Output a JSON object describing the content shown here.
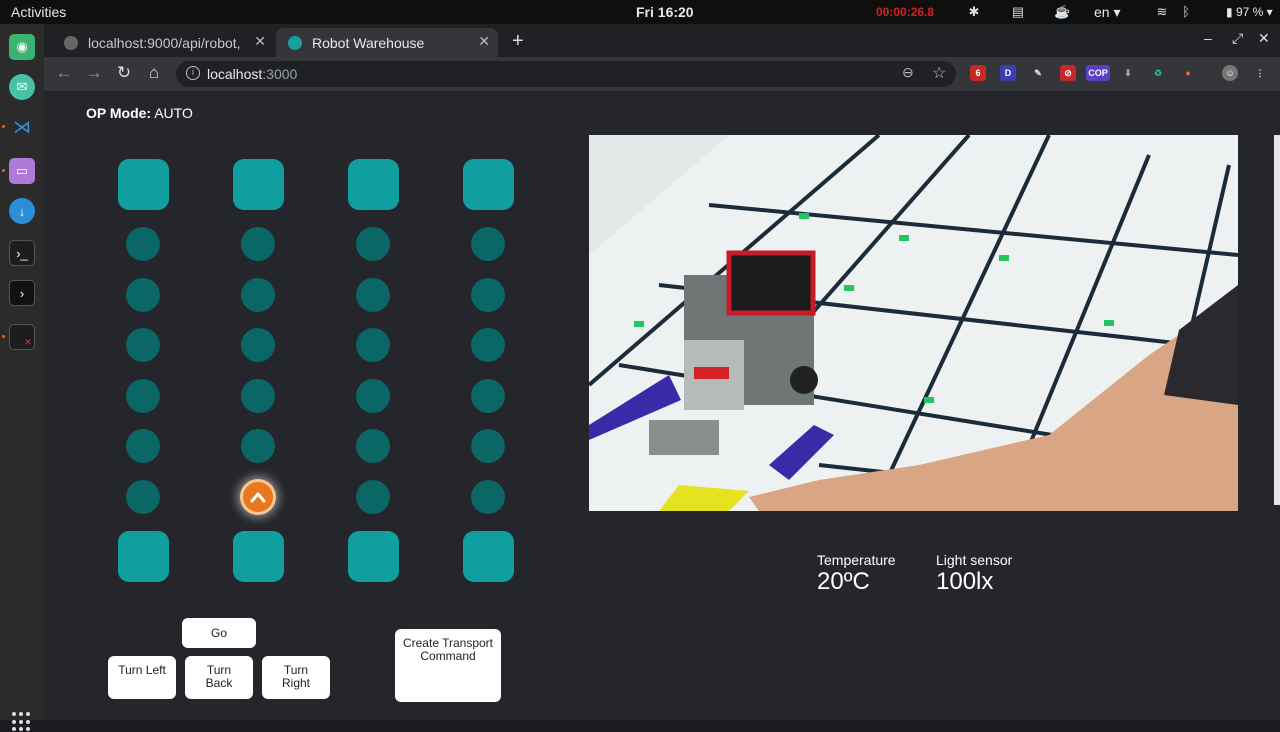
{
  "system": {
    "activities_label": "Activities",
    "clock": "Fri 16:20",
    "recording": "00:00:26.8",
    "language": "en",
    "battery": "97 %"
  },
  "browser": {
    "tabs": [
      {
        "title": "localhost:9000/api/robot,"
      },
      {
        "title": "Robot Warehouse"
      }
    ],
    "url_host": "localhost",
    "url_port": ":3000",
    "ext_badge_count": "6",
    "ext_letter": "D",
    "ext_cop": "COP"
  },
  "page": {
    "op_mode_label": "OP Mode:",
    "op_mode_value": "AUTO",
    "grid": {
      "columns": 4,
      "node_rows": 6,
      "robot_column": 2,
      "robot_node_row": 6,
      "robot_direction": "up"
    },
    "buttons": {
      "go": "Go",
      "turn_left": "Turn Left",
      "turn_back": "Turn Back",
      "turn_right": "Turn Right",
      "create_transport": "Create Transport Command"
    },
    "sensors": {
      "temperature_label": "Temperature",
      "temperature_value": "20ºC",
      "light_label": "Light sensor",
      "light_value": "100lx"
    },
    "colors": {
      "station": "#119e9e",
      "node": "#0b6666",
      "robot": "#e8771d",
      "background": "#25262b"
    }
  }
}
